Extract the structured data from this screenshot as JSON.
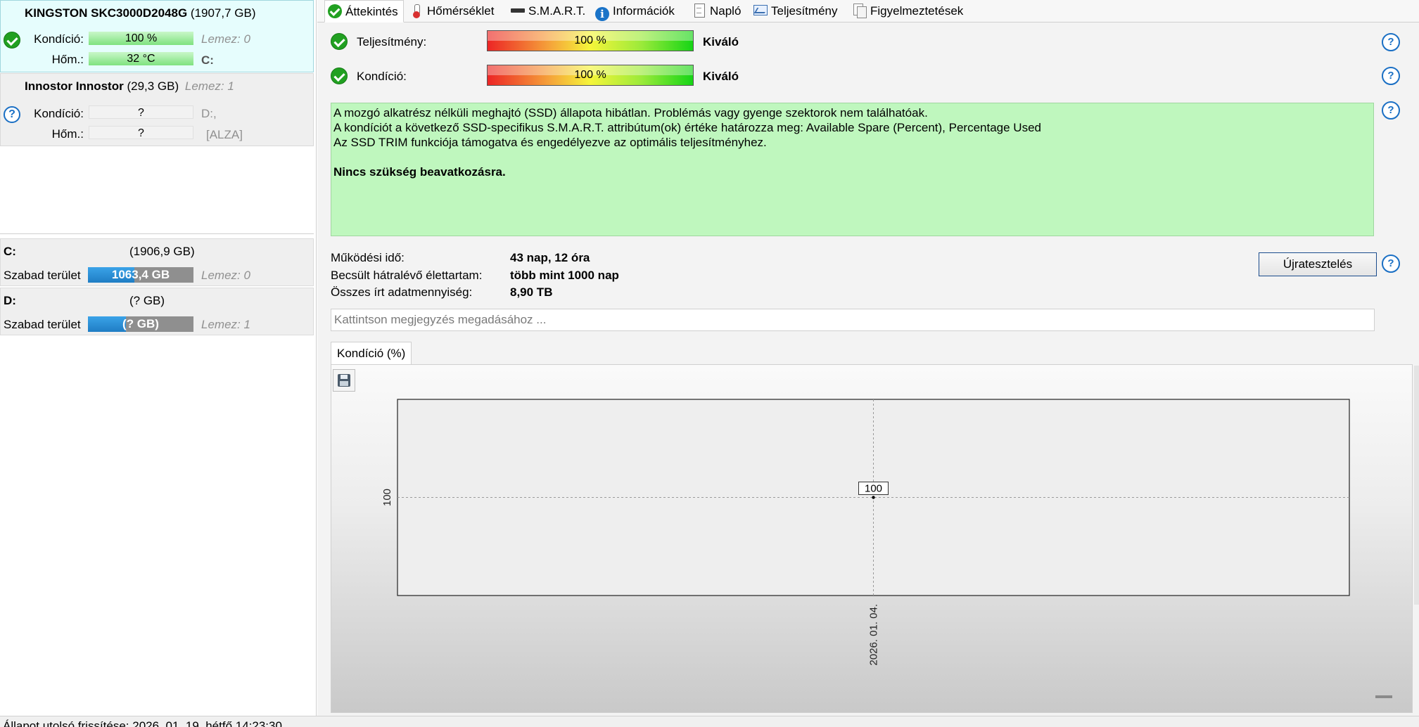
{
  "drives": [
    {
      "model": "KINGSTON SKC3000D2048G",
      "size": "(1907,7 GB)",
      "status": "ok",
      "health_label": "Kondíció:",
      "health_value": "100 %",
      "health_percent": 100,
      "disk_note": "Lemez: 0",
      "temp_label": "Hőm.:",
      "temp_value": "32 °C",
      "letters": "C:"
    },
    {
      "model": "Innostor Innostor",
      "size": "(29,3 GB)",
      "disk_note": "Lemez: 1",
      "status": "unknown",
      "health_label": "Kondíció:",
      "health_value": "?",
      "letters": "D:,",
      "temp_label": "Hőm.:",
      "temp_value": "?",
      "extra": "[ALZA]"
    }
  ],
  "volumes": [
    {
      "letter": "C:",
      "size": "(1906,9 GB)",
      "free_label": "Szabad terület",
      "free_value": "1063,4 GB",
      "used_fraction": 0.44,
      "disk_note": "Lemez: 0"
    },
    {
      "letter": "D:",
      "size": "(? GB)",
      "free_label": "Szabad terület",
      "free_value": "(? GB)",
      "used_fraction": 0.36,
      "disk_note": "Lemez: 1"
    }
  ],
  "tabs": [
    {
      "label": "Áttekintés",
      "icon": "check-icon"
    },
    {
      "label": "Hőmérséklet",
      "icon": "thermometer-icon"
    },
    {
      "label": "S.M.A.R.T.",
      "icon": "disk-icon"
    },
    {
      "label": "Információk",
      "icon": "info-icon"
    },
    {
      "label": "Napló",
      "icon": "document-icon"
    },
    {
      "label": "Teljesítmény",
      "icon": "performance-chart-icon"
    },
    {
      "label": "Figyelmeztetések",
      "icon": "copy-pages-icon"
    }
  ],
  "overview": {
    "performance_label": "Teljesítmény:",
    "performance_value": "100 %",
    "performance_percent": 100,
    "performance_rating": "Kiváló",
    "health_label": "Kondíció:",
    "health_value": "100 %",
    "health_percent": 100,
    "health_rating": "Kiváló",
    "message_lines": [
      "A mozgó alkatrész nélküli meghajtó (SSD) állapota hibátlan. Problémás vagy gyenge szektorok nem találhatóak.",
      "A kondíciót a következő SSD-specifikus S.M.A.R.T. attribútum(ok) értéke határozza meg:  Available Spare (Percent), Percentage Used",
      "Az SSD TRIM funkciója támogatva és engedélyezve az optimális teljesítményhez."
    ],
    "message_action": "Nincs szükség beavatkozásra.",
    "uptime_label": "Működési idő:",
    "uptime_value": "43 nap, 12 óra",
    "lifetime_label": "Becsült hátralévő élettartam:",
    "lifetime_value": "több mint 1000 nap",
    "written_label": "Összes írt adatmennyiség:",
    "written_value": "8,90 TB",
    "retest_label": "Újratesztelés",
    "note_placeholder": "Kattintson megjegyzés megadásához ..."
  },
  "chart_tab_label": "Kondíció  (%)",
  "chart_data": {
    "type": "line",
    "title": "",
    "xlabel": "",
    "ylabel": "",
    "x": [
      "2026. 01. 04."
    ],
    "series": [
      {
        "values": [
          100
        ]
      }
    ],
    "y_ticks": [
      100
    ],
    "point_labels": [
      "100"
    ],
    "grid": true
  },
  "status_bar": "Állapot utolsó frissítése: 2026. 01. 19. hétfő 14:23:30"
}
